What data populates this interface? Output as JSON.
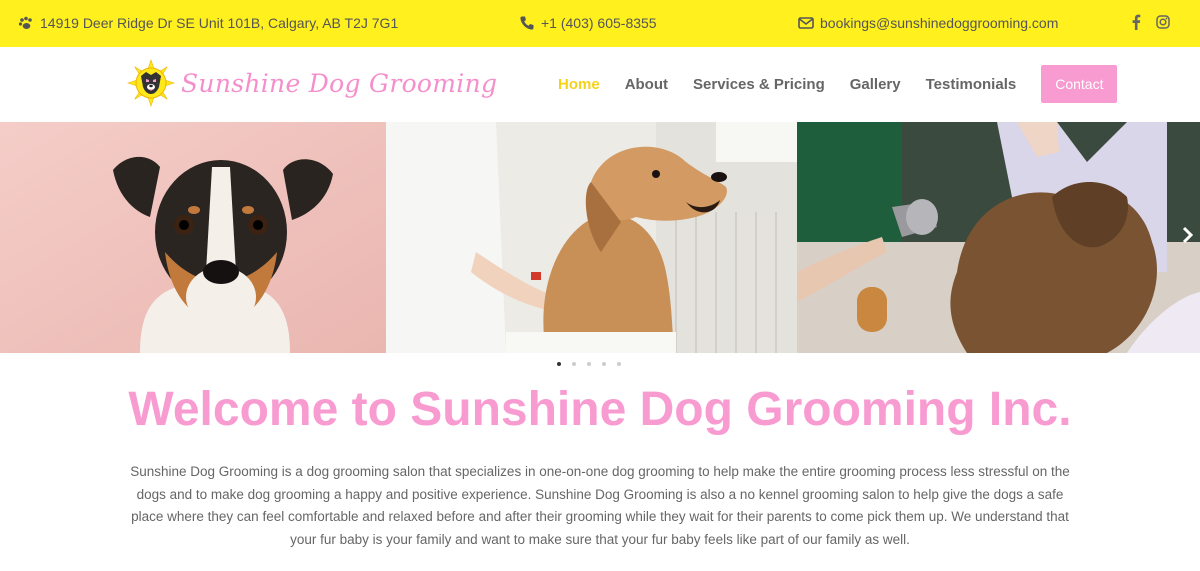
{
  "topbar": {
    "address": "14919 Deer Ridge Dr SE Unit 101B, Calgary, AB T2J 7G1",
    "phone": "+1 (403) 605-8355",
    "email": "bookings@sunshinedoggrooming.com",
    "icons": [
      "paw-icon",
      "phone-icon",
      "envelope-icon",
      "facebook-icon",
      "instagram-icon"
    ]
  },
  "header": {
    "logo_text": "Sunshine Dog Grooming",
    "nav": [
      "Home",
      "About",
      "Services & Pricing",
      "Gallery",
      "Testimonials"
    ],
    "contact_label": "Contact"
  },
  "slider": {
    "slide_count": 5,
    "active_slide": 1
  },
  "main": {
    "title": "Welcome to Sunshine Dog Grooming Inc.",
    "intro": "Sunshine Dog Grooming is a dog grooming salon that specializes in one-on-one dog grooming to help make the entire grooming process less stressful on the dogs and to make dog grooming a happy and positive experience. Sunshine Dog Grooming is also a no kennel grooming salon to help give the dogs a safe place where they can feel comfortable and relaxed before and after their grooming while they wait for their parents to come pick them up. We understand that your fur baby is your family and want to make sure that your fur baby feels like part of our family as well."
  },
  "colors": {
    "topbar_bg": "#fff01e",
    "brand_pink": "#f79bd1",
    "nav_active": "#f6d21a",
    "text_gray": "#666666"
  }
}
